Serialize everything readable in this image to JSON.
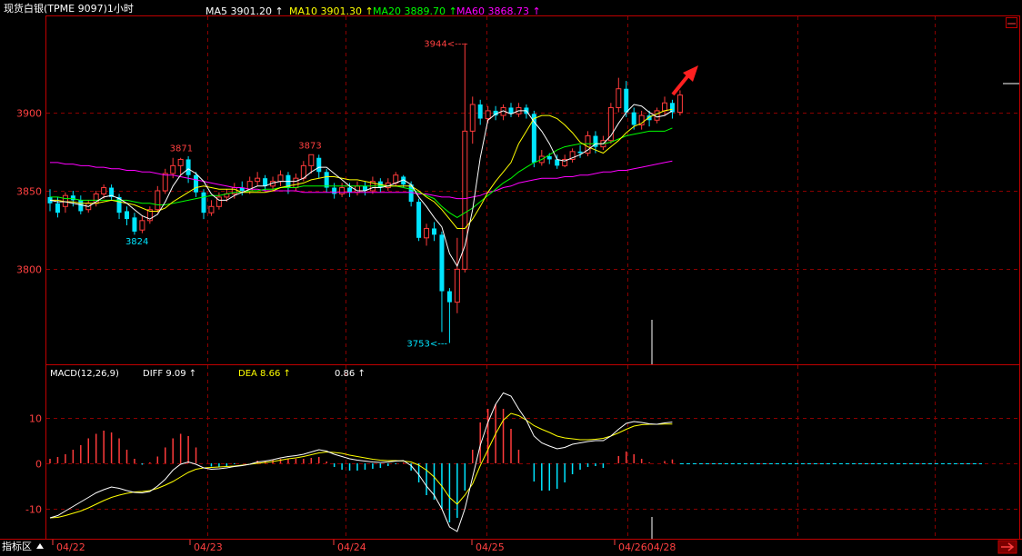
{
  "header": {
    "title": "现货白银(TPME 9097)1小时",
    "ma5": "MA5 3901.20 ↑",
    "ma10": "MA10 3901.30 ↑",
    "ma20": "MA20 3889.70 ↑",
    "ma60": "MA60 3868.73 ↑"
  },
  "macd_header": {
    "name": "MACD(12,26,9)",
    "diff": "DIFF  9.09 ↑",
    "dea": "DEA  8.66 ↑",
    "macd": "0.86 ↑"
  },
  "bottom_bar": {
    "indicator_tab": "指标区",
    "dates": [
      "04/22",
      "04/23",
      "04/24",
      "04/25",
      "04/2604/28"
    ]
  },
  "colors": {
    "up": "#ff3b3b",
    "down": "#00e5ff",
    "ma5": "#ffffff",
    "ma10": "#ffff00",
    "ma20": "#00ff00",
    "ma60": "#ff00ff",
    "grid": "#8b0000",
    "axis_text": "#ff4040"
  },
  "chart_data": [
    {
      "type": "candlestick",
      "title": "现货白银(TPME 9097)1小时",
      "y_ticks": [
        3800,
        3850,
        3900
      ],
      "ylim": [
        3740,
        3960
      ],
      "annotations": [
        {
          "label": "3944",
          "value": 3944
        },
        {
          "label": "3871",
          "value": 3871
        },
        {
          "label": "3873",
          "value": 3873
        },
        {
          "label": "3824",
          "value": 3824
        },
        {
          "label": "3753",
          "value": 3753
        }
      ],
      "candles": [
        [
          3846,
          3842,
          3851,
          3837
        ],
        [
          3842,
          3836,
          3846,
          3833
        ],
        [
          3840,
          3847,
          3849,
          3836
        ],
        [
          3847,
          3844,
          3850,
          3840
        ],
        [
          3844,
          3837,
          3847,
          3835
        ],
        [
          3838,
          3842,
          3844,
          3836
        ],
        [
          3842,
          3848,
          3850,
          3840
        ],
        [
          3848,
          3852,
          3854,
          3845
        ],
        [
          3852,
          3846,
          3854,
          3844
        ],
        [
          3846,
          3836,
          3848,
          3832
        ],
        [
          3837,
          3832,
          3840,
          3828
        ],
        [
          3833,
          3824,
          3836,
          3822
        ],
        [
          3825,
          3831,
          3834,
          3823
        ],
        [
          3831,
          3838,
          3840,
          3829
        ],
        [
          3838,
          3850,
          3853,
          3836
        ],
        [
          3850,
          3861,
          3864,
          3848
        ],
        [
          3861,
          3866,
          3871,
          3858
        ],
        [
          3866,
          3870,
          3871,
          3860
        ],
        [
          3870,
          3860,
          3872,
          3855
        ],
        [
          3860,
          3849,
          3862,
          3846
        ],
        [
          3849,
          3836,
          3851,
          3832
        ],
        [
          3836,
          3840,
          3844,
          3834
        ],
        [
          3840,
          3846,
          3849,
          3838
        ],
        [
          3846,
          3848,
          3851,
          3843
        ],
        [
          3848,
          3852,
          3855,
          3845
        ],
        [
          3852,
          3850,
          3856,
          3847
        ],
        [
          3850,
          3856,
          3859,
          3848
        ],
        [
          3856,
          3858,
          3862,
          3853
        ],
        [
          3858,
          3853,
          3860,
          3850
        ],
        [
          3853,
          3856,
          3859,
          3850
        ],
        [
          3856,
          3860,
          3863,
          3853
        ],
        [
          3860,
          3852,
          3862,
          3848
        ],
        [
          3852,
          3858,
          3861,
          3850
        ],
        [
          3858,
          3866,
          3869,
          3856
        ],
        [
          3866,
          3873,
          3873,
          3861
        ],
        [
          3871,
          3862,
          3873,
          3858
        ],
        [
          3862,
          3852,
          3864,
          3849
        ],
        [
          3852,
          3848,
          3855,
          3845
        ],
        [
          3848,
          3852,
          3855,
          3846
        ],
        [
          3852,
          3849,
          3855,
          3846
        ],
        [
          3849,
          3853,
          3856,
          3847
        ],
        [
          3853,
          3850,
          3856,
          3847
        ],
        [
          3850,
          3856,
          3859,
          3848
        ],
        [
          3856,
          3852,
          3858,
          3849
        ],
        [
          3852,
          3855,
          3858,
          3850
        ],
        [
          3855,
          3860,
          3862,
          3853
        ],
        [
          3859,
          3854,
          3860,
          3852
        ],
        [
          3854,
          3843,
          3856,
          3840
        ],
        [
          3843,
          3820,
          3845,
          3818
        ],
        [
          3820,
          3826,
          3829,
          3815
        ],
        [
          3826,
          3822,
          3830,
          3818
        ],
        [
          3822,
          3786,
          3824,
          3760
        ],
        [
          3786,
          3779,
          3788,
          3753
        ],
        [
          3779,
          3800,
          3820,
          3772
        ],
        [
          3800,
          3888,
          3944,
          3798
        ],
        [
          3888,
          3905,
          3910,
          3880
        ],
        [
          3905,
          3896,
          3908,
          3892
        ],
        [
          3896,
          3901,
          3904,
          3893
        ],
        [
          3901,
          3898,
          3904,
          3895
        ],
        [
          3898,
          3903,
          3905,
          3895
        ],
        [
          3903,
          3899,
          3906,
          3897
        ],
        [
          3899,
          3903,
          3906,
          3897
        ],
        [
          3903,
          3899,
          3905,
          3896
        ],
        [
          3899,
          3868,
          3901,
          3865
        ],
        [
          3868,
          3872,
          3876,
          3866
        ],
        [
          3872,
          3870,
          3874,
          3867
        ],
        [
          3870,
          3866,
          3873,
          3864
        ],
        [
          3866,
          3870,
          3873,
          3865
        ],
        [
          3870,
          3875,
          3877,
          3868
        ],
        [
          3875,
          3874,
          3879,
          3871
        ],
        [
          3874,
          3885,
          3888,
          3872
        ],
        [
          3885,
          3878,
          3888,
          3874
        ],
        [
          3878,
          3882,
          3885,
          3876
        ],
        [
          3882,
          3903,
          3906,
          3880
        ],
        [
          3903,
          3915,
          3922,
          3900
        ],
        [
          3915,
          3900,
          3920,
          3897
        ],
        [
          3900,
          3892,
          3903,
          3889
        ],
        [
          3892,
          3898,
          3901,
          3889
        ],
        [
          3898,
          3895,
          3901,
          3891
        ],
        [
          3895,
          3901,
          3903,
          3893
        ],
        [
          3901,
          3906,
          3910,
          3898
        ],
        [
          3906,
          3900,
          3908,
          3896
        ],
        [
          3900,
          3911,
          3914,
          3898
        ]
      ],
      "ma5": [
        3844,
        3843,
        3843,
        3842,
        3841,
        3840,
        3843,
        3846,
        3847,
        3845,
        3842,
        3838,
        3834,
        3832,
        3835,
        3843,
        3853,
        3860,
        3864,
        3861,
        3856,
        3848,
        3844,
        3844,
        3847,
        3849,
        3851,
        3853,
        3853,
        3855,
        3856,
        3856,
        3856,
        3858,
        3862,
        3865,
        3865,
        3861,
        3857,
        3853,
        3850,
        3850,
        3852,
        3852,
        3853,
        3855,
        3857,
        3854,
        3846,
        3840,
        3833,
        3827,
        3810,
        3802,
        3815,
        3838,
        3871,
        3895,
        3899,
        3901,
        3899,
        3901,
        3901,
        3894,
        3888,
        3880,
        3870,
        3869,
        3871,
        3873,
        3876,
        3880,
        3880,
        3885,
        3893,
        3900,
        3905,
        3904,
        3900,
        3897,
        3898,
        3901
      ],
      "ma10": [
        3844,
        3844,
        3843,
        3843,
        3842,
        3842,
        3842,
        3843,
        3844,
        3843,
        3842,
        3841,
        3839,
        3837,
        3837,
        3839,
        3843,
        3846,
        3849,
        3852,
        3853,
        3852,
        3851,
        3851,
        3851,
        3849,
        3849,
        3849,
        3849,
        3850,
        3852,
        3853,
        3854,
        3855,
        3857,
        3858,
        3859,
        3859,
        3858,
        3857,
        3857,
        3856,
        3855,
        3854,
        3853,
        3853,
        3853,
        3853,
        3850,
        3846,
        3843,
        3838,
        3832,
        3826,
        3826,
        3832,
        3840,
        3849,
        3856,
        3862,
        3868,
        3880,
        3888,
        3896,
        3898,
        3898,
        3896,
        3892,
        3887,
        3881,
        3878,
        3876,
        3874,
        3878,
        3882,
        3887,
        3891,
        3893,
        3897,
        3899,
        3901,
        3902
      ],
      "ma20": [
        3846,
        3846,
        3845,
        3845,
        3844,
        3844,
        3844,
        3844,
        3844,
        3844,
        3844,
        3843,
        3842,
        3842,
        3841,
        3841,
        3842,
        3843,
        3844,
        3845,
        3846,
        3847,
        3847,
        3848,
        3849,
        3849,
        3850,
        3850,
        3851,
        3851,
        3852,
        3852,
        3852,
        3853,
        3853,
        3853,
        3853,
        3853,
        3853,
        3853,
        3853,
        3853,
        3853,
        3853,
        3853,
        3853,
        3852,
        3851,
        3849,
        3847,
        3845,
        3840,
        3836,
        3833,
        3836,
        3839,
        3843,
        3847,
        3851,
        3855,
        3858,
        3862,
        3865,
        3868,
        3870,
        3873,
        3876,
        3878,
        3879,
        3880,
        3880,
        3880,
        3880,
        3881,
        3883,
        3885,
        3886,
        3887,
        3888,
        3888,
        3888,
        3890
      ],
      "ma60": [
        3868,
        3868,
        3867,
        3867,
        3866,
        3866,
        3865,
        3865,
        3864,
        3864,
        3863,
        3863,
        3862,
        3862,
        3861,
        3860,
        3860,
        3859,
        3858,
        3857,
        3856,
        3855,
        3854,
        3853,
        3852,
        3852,
        3851,
        3851,
        3850,
        3850,
        3850,
        3850,
        3850,
        3849,
        3849,
        3849,
        3849,
        3849,
        3849,
        3849,
        3849,
        3849,
        3849,
        3849,
        3849,
        3849,
        3849,
        3849,
        3848,
        3848,
        3847,
        3846,
        3846,
        3845,
        3845,
        3846,
        3847,
        3849,
        3850,
        3852,
        3853,
        3855,
        3856,
        3857,
        3858,
        3858,
        3858,
        3859,
        3859,
        3860,
        3860,
        3861,
        3862,
        3862,
        3863,
        3863,
        3864,
        3865,
        3866,
        3867,
        3868,
        3869
      ]
    },
    {
      "type": "macd",
      "title": "MACD(12,26,9)",
      "y_ticks": [
        -10,
        0,
        10
      ],
      "ylim": [
        -16,
        18
      ],
      "diff": [
        -12,
        -11.5,
        -10.5,
        -9.5,
        -8.5,
        -7.5,
        -6.5,
        -5.8,
        -5.2,
        -5.5,
        -6,
        -6.4,
        -6.5,
        -6.2,
        -5,
        -3.5,
        -1.5,
        -0.2,
        0.3,
        -0.2,
        -1,
        -1.3,
        -1.2,
        -1,
        -0.7,
        -0.5,
        -0.2,
        0.3,
        0.5,
        0.8,
        1.2,
        1.5,
        1.7,
        2,
        2.5,
        3,
        2.7,
        2,
        1.5,
        1,
        0.7,
        0.5,
        0.3,
        0.2,
        0.3,
        0.5,
        0.6,
        -0.5,
        -2.5,
        -5,
        -7,
        -10,
        -14,
        -15,
        -10,
        -3,
        4,
        9,
        13,
        15.5,
        14.8,
        12,
        9.5,
        6,
        4.5,
        3.8,
        3.2,
        3.5,
        4.2,
        4.5,
        4.8,
        5,
        5,
        6,
        7.5,
        8.8,
        9.2,
        9,
        8.7,
        8.6,
        8.9,
        9.09
      ],
      "dea": [
        -12,
        -11.9,
        -11.5,
        -11,
        -10.5,
        -9.8,
        -9,
        -8.2,
        -7.5,
        -7,
        -6.6,
        -6.3,
        -6.2,
        -6,
        -5.5,
        -4.8,
        -4,
        -3,
        -2,
        -1.3,
        -1,
        -0.9,
        -0.8,
        -0.7,
        -0.6,
        -0.4,
        -0.2,
        0,
        0.2,
        0.4,
        0.7,
        1,
        1.2,
        1.5,
        1.9,
        2.3,
        2.5,
        2.4,
        2.2,
        1.8,
        1.5,
        1.2,
        0.9,
        0.7,
        0.6,
        0.6,
        0.5,
        0.3,
        -0.4,
        -1.5,
        -3,
        -5,
        -7.5,
        -9,
        -7,
        -4.5,
        -0.5,
        3,
        6.5,
        9.5,
        11,
        10.5,
        9.5,
        8.3,
        7.5,
        6.8,
        6,
        5.6,
        5.4,
        5.2,
        5.2,
        5.3,
        5.5,
        6,
        6.7,
        7.5,
        8.2,
        8.5,
        8.6,
        8.6,
        8.65,
        8.66
      ],
      "macd": [
        1,
        1.4,
        2,
        3,
        4,
        5.5,
        6.5,
        7.2,
        6.8,
        5.5,
        3,
        1,
        -0.3,
        0.2,
        1.5,
        3.5,
        5.5,
        6.5,
        6,
        3.5,
        0,
        -0.7,
        -0.8,
        -0.6,
        -0.2,
        0,
        0,
        0.6,
        0.6,
        0.8,
        1,
        1,
        1,
        1,
        1.2,
        1.4,
        0.4,
        -0.8,
        -1.4,
        -1.6,
        -1.6,
        -1.4,
        -1.2,
        -1,
        -0.6,
        -0.2,
        0.2,
        -1.6,
        -4.2,
        -7,
        -8,
        -10,
        -13,
        -12,
        -6,
        3,
        9,
        12,
        13,
        12,
        7.6,
        3,
        0,
        -4,
        -6,
        -6,
        -5.6,
        -4.2,
        -2.4,
        -1.4,
        -0.8,
        -0.6,
        -1,
        0,
        1.6,
        2.6,
        2,
        1,
        0.2,
        0,
        0.5,
        0.86
      ]
    }
  ]
}
